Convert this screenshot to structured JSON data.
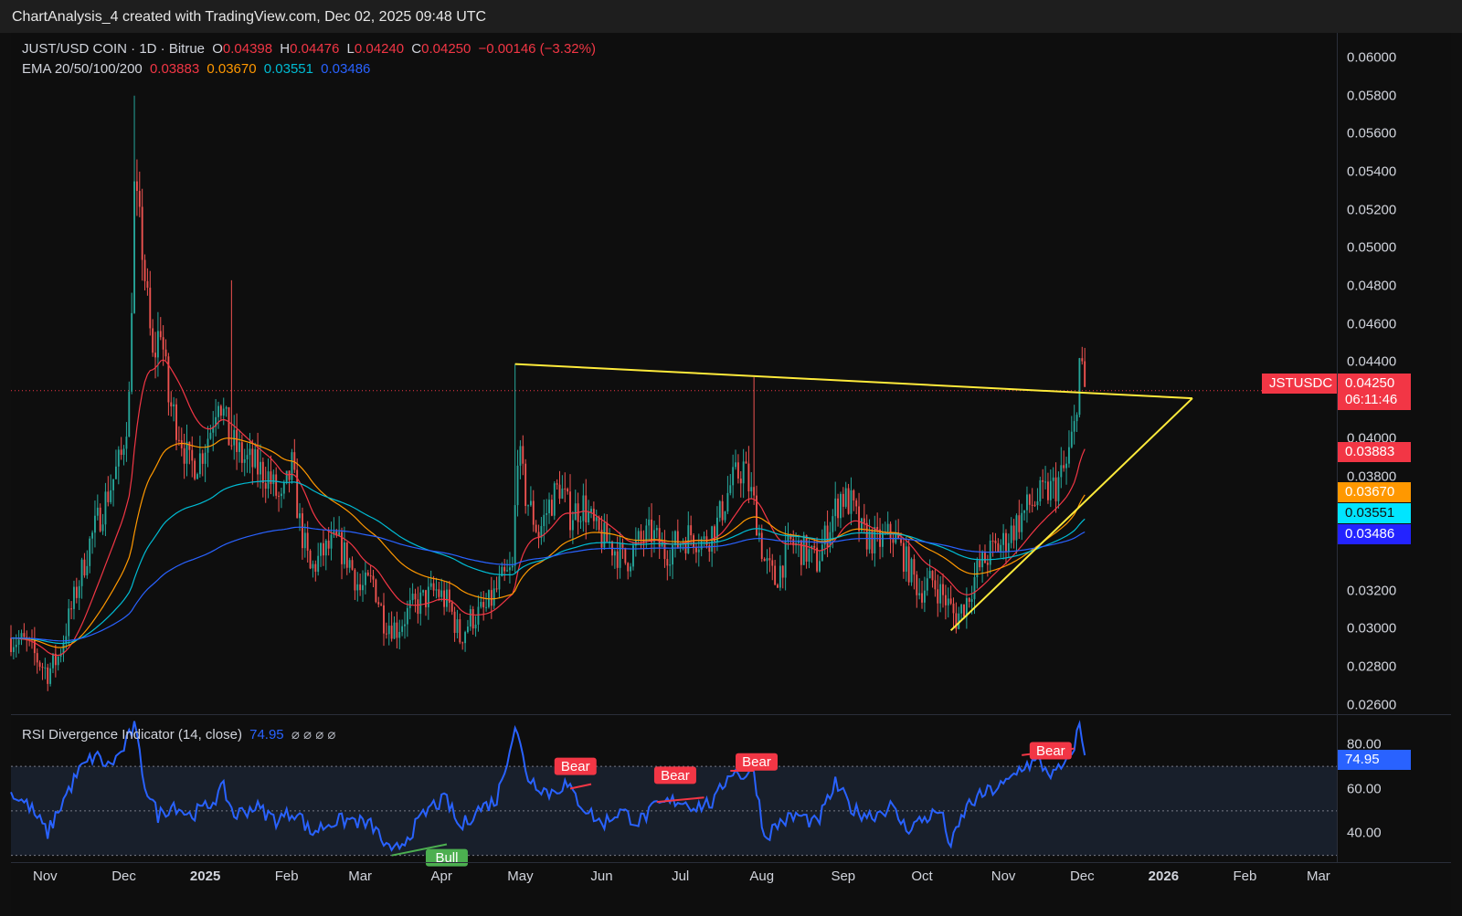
{
  "header": {
    "title": "ChartAnalysis_4 created with TradingView.com, Dec 02, 2025 09:48 UTC"
  },
  "legend": {
    "symbol": "JUST/USD COIN · 1D · Bitrue",
    "o_label": "O",
    "o": "0.04398",
    "h_label": "H",
    "h": "0.04476",
    "l_label": "L",
    "l": "0.04240",
    "c_label": "C",
    "c": "0.04250",
    "change": "−0.00146 (−3.32%)",
    "ema_label": "EMA 20/50/100/200",
    "ema20": "0.03883",
    "ema50": "0.03670",
    "ema100": "0.03551",
    "ema200": "0.03486"
  },
  "rsi_legend": {
    "label": "RSI Divergence Indicator (14, close)",
    "value": "74.95",
    "marks": "⌀ ⌀ ⌀ ⌀"
  },
  "colors": {
    "up": "#26a69a",
    "down": "#ef5350",
    "ema20": "#f23645",
    "ema50": "#ff9800",
    "ema100": "#00bcd4",
    "ema200": "#2962ff",
    "trend": "#ffeb3b",
    "rsi": "#2962ff"
  },
  "price_tags": {
    "symbol": "JSTUSDC",
    "price": "0.04250",
    "countdown": "06:11:46",
    "ema20": "0.03883",
    "ema50": "0.03670",
    "ema100": "0.03551",
    "ema200": "0.03486",
    "rsi": "74.95"
  },
  "chart_data": [
    {
      "type": "candlestick",
      "title": "JUST/USD COIN · 1D · Bitrue",
      "ylim": [
        0.0255,
        0.0613
      ],
      "y_ticks": [
        "0.06000",
        "0.05800",
        "0.05600",
        "0.05400",
        "0.05200",
        "0.05000",
        "0.04800",
        "0.04600",
        "0.04400",
        "0.04000",
        "0.03800",
        "0.03200",
        "0.03000",
        "0.02800",
        "0.02600"
      ],
      "x_ticks": [
        "Nov",
        "Dec",
        "2025",
        "Feb",
        "Mar",
        "Apr",
        "May",
        "Jun",
        "Jul",
        "Aug",
        "Sep",
        "Oct",
        "Nov",
        "Dec",
        "2026",
        "Feb",
        "Mar"
      ],
      "x_range": [
        "2024-10-19",
        "2026-03-08"
      ],
      "close_series": [
        [
          "2024-10-19",
          0.0295
        ],
        [
          "2024-10-25",
          0.0292
        ],
        [
          "2024-10-29",
          0.0284
        ],
        [
          "2024-11-02",
          0.0277
        ],
        [
          "2024-11-06",
          0.0285
        ],
        [
          "2024-11-10",
          0.0305
        ],
        [
          "2024-11-14",
          0.0325
        ],
        [
          "2024-11-18",
          0.0345
        ],
        [
          "2024-11-22",
          0.036
        ],
        [
          "2024-11-26",
          0.0375
        ],
        [
          "2024-11-30",
          0.039
        ],
        [
          "2024-12-03",
          0.042
        ],
        [
          "2024-12-05",
          0.053
        ],
        [
          "2024-12-08",
          0.05
        ],
        [
          "2024-12-12",
          0.044
        ],
        [
          "2024-12-15",
          0.046
        ],
        [
          "2024-12-18",
          0.042
        ],
        [
          "2024-12-22",
          0.0405
        ],
        [
          "2024-12-26",
          0.0385
        ],
        [
          "2024-12-30",
          0.039
        ],
        [
          "2025-01-03",
          0.0405
        ],
        [
          "2025-01-06",
          0.0425
        ],
        [
          "2025-01-10",
          0.04
        ],
        [
          "2025-01-15",
          0.039
        ],
        [
          "2025-01-20",
          0.0385
        ],
        [
          "2025-01-25",
          0.038
        ],
        [
          "2025-01-30",
          0.0365
        ],
        [
          "2025-02-03",
          0.0385
        ],
        [
          "2025-02-06",
          0.0355
        ],
        [
          "2025-02-10",
          0.033
        ],
        [
          "2025-02-15",
          0.034
        ],
        [
          "2025-02-20",
          0.0345
        ],
        [
          "2025-02-25",
          0.0335
        ],
        [
          "2025-03-01",
          0.032
        ],
        [
          "2025-03-06",
          0.0325
        ],
        [
          "2025-03-10",
          0.0305
        ],
        [
          "2025-03-15",
          0.03
        ],
        [
          "2025-03-20",
          0.031
        ],
        [
          "2025-03-25",
          0.0315
        ],
        [
          "2025-03-30",
          0.032
        ],
        [
          "2025-04-04",
          0.0312
        ],
        [
          "2025-04-08",
          0.0295
        ],
        [
          "2025-04-12",
          0.0305
        ],
        [
          "2025-04-18",
          0.031
        ],
        [
          "2025-04-24",
          0.0325
        ],
        [
          "2025-04-28",
          0.033
        ],
        [
          "2025-04-30",
          0.0395
        ],
        [
          "2025-05-03",
          0.037
        ],
        [
          "2025-05-08",
          0.035
        ],
        [
          "2025-05-12",
          0.0365
        ],
        [
          "2025-05-16",
          0.0375
        ],
        [
          "2025-05-20",
          0.036
        ],
        [
          "2025-05-25",
          0.0365
        ],
        [
          "2025-05-30",
          0.035
        ],
        [
          "2025-06-04",
          0.0345
        ],
        [
          "2025-06-10",
          0.0335
        ],
        [
          "2025-06-15",
          0.0345
        ],
        [
          "2025-06-20",
          0.035
        ],
        [
          "2025-06-25",
          0.034
        ],
        [
          "2025-06-30",
          0.0345
        ],
        [
          "2025-07-05",
          0.035
        ],
        [
          "2025-07-10",
          0.0345
        ],
        [
          "2025-07-15",
          0.0355
        ],
        [
          "2025-07-20",
          0.0375
        ],
        [
          "2025-07-25",
          0.0385
        ],
        [
          "2025-07-29",
          0.0365
        ],
        [
          "2025-08-02",
          0.0335
        ],
        [
          "2025-08-06",
          0.0325
        ],
        [
          "2025-08-12",
          0.0345
        ],
        [
          "2025-08-18",
          0.034
        ],
        [
          "2025-08-22",
          0.0335
        ],
        [
          "2025-08-27",
          0.0355
        ],
        [
          "2025-08-31",
          0.037
        ],
        [
          "2025-09-04",
          0.0365
        ],
        [
          "2025-09-08",
          0.035
        ],
        [
          "2025-09-14",
          0.0345
        ],
        [
          "2025-09-20",
          0.035
        ],
        [
          "2025-09-25",
          0.0335
        ],
        [
          "2025-09-30",
          0.032
        ],
        [
          "2025-10-05",
          0.0325
        ],
        [
          "2025-10-10",
          0.0315
        ],
        [
          "2025-10-14",
          0.0305
        ],
        [
          "2025-10-18",
          0.0315
        ],
        [
          "2025-10-22",
          0.033
        ],
        [
          "2025-10-27",
          0.034
        ],
        [
          "2025-11-01",
          0.0345
        ],
        [
          "2025-11-06",
          0.0355
        ],
        [
          "2025-11-11",
          0.0365
        ],
        [
          "2025-11-16",
          0.037
        ],
        [
          "2025-11-21",
          0.0375
        ],
        [
          "2025-11-25",
          0.0385
        ],
        [
          "2025-11-28",
          0.0405
        ],
        [
          "2025-11-30",
          0.044
        ],
        [
          "2025-12-02",
          0.0425
        ]
      ],
      "events": [
        {
          "date": "2024-12-05",
          "high": 0.058
        },
        {
          "date": "2025-01-11",
          "high": 0.0483
        },
        {
          "date": "2025-04-29",
          "high": 0.0439
        },
        {
          "date": "2025-07-29",
          "high": 0.0432
        },
        {
          "date": "2025-12-01",
          "high": 0.0448
        }
      ],
      "series": [
        {
          "name": "EMA 20",
          "last": 0.03883
        },
        {
          "name": "EMA 50",
          "last": 0.0367
        },
        {
          "name": "EMA 100",
          "last": 0.03551
        },
        {
          "name": "EMA 200",
          "last": 0.03486
        }
      ],
      "trendlines": [
        {
          "from": [
            "2025-04-29",
            0.0439
          ],
          "to": [
            "2026-01-12",
            0.0421
          ]
        },
        {
          "from": [
            "2025-10-12",
            0.0299
          ],
          "to": [
            "2026-01-12",
            0.0421
          ]
        }
      ]
    },
    {
      "type": "line",
      "title": "RSI Divergence Indicator (14, close)",
      "ylim": [
        27,
        93
      ],
      "y_ticks": [
        "80.00",
        "60.00",
        "40.00"
      ],
      "bands": [
        30,
        50,
        70
      ],
      "last": 74.95,
      "series": [
        [
          "2024-10-19",
          58
        ],
        [
          "2024-10-26",
          52
        ],
        [
          "2024-11-02",
          40
        ],
        [
          "2024-11-08",
          55
        ],
        [
          "2024-11-14",
          68
        ],
        [
          "2024-11-20",
          75
        ],
        [
          "2024-11-25",
          70
        ],
        [
          "2024-11-30",
          76
        ],
        [
          "2024-12-05",
          88
        ],
        [
          "2024-12-09",
          62
        ],
        [
          "2024-12-14",
          48
        ],
        [
          "2024-12-20",
          53
        ],
        [
          "2024-12-26",
          48
        ],
        [
          "2025-01-02",
          52
        ],
        [
          "2025-01-08",
          60
        ],
        [
          "2025-01-12",
          48
        ],
        [
          "2025-01-20",
          52
        ],
        [
          "2025-01-28",
          46
        ],
        [
          "2025-02-05",
          50
        ],
        [
          "2025-02-10",
          40
        ],
        [
          "2025-02-18",
          45
        ],
        [
          "2025-02-26",
          46
        ],
        [
          "2025-03-06",
          43
        ],
        [
          "2025-03-13",
          30
        ],
        [
          "2025-03-20",
          40
        ],
        [
          "2025-03-28",
          52
        ],
        [
          "2025-04-03",
          55
        ],
        [
          "2025-04-08",
          42
        ],
        [
          "2025-04-14",
          50
        ],
        [
          "2025-04-22",
          55
        ],
        [
          "2025-04-29",
          88
        ],
        [
          "2025-05-04",
          65
        ],
        [
          "2025-05-12",
          58
        ],
        [
          "2025-05-18",
          62
        ],
        [
          "2025-05-25",
          52
        ],
        [
          "2025-06-01",
          44
        ],
        [
          "2025-06-08",
          50
        ],
        [
          "2025-06-15",
          45
        ],
        [
          "2025-06-22",
          52
        ],
        [
          "2025-06-30",
          55
        ],
        [
          "2025-07-07",
          52
        ],
        [
          "2025-07-14",
          54
        ],
        [
          "2025-07-20",
          68
        ],
        [
          "2025-07-25",
          66
        ],
        [
          "2025-07-29",
          68
        ],
        [
          "2025-08-02",
          38
        ],
        [
          "2025-08-08",
          45
        ],
        [
          "2025-08-15",
          48
        ],
        [
          "2025-08-22",
          44
        ],
        [
          "2025-08-29",
          62
        ],
        [
          "2025-09-05",
          50
        ],
        [
          "2025-09-12",
          48
        ],
        [
          "2025-09-19",
          52
        ],
        [
          "2025-09-25",
          42
        ],
        [
          "2025-10-01",
          46
        ],
        [
          "2025-10-08",
          50
        ],
        [
          "2025-10-12",
          34
        ],
        [
          "2025-10-18",
          52
        ],
        [
          "2025-10-25",
          58
        ],
        [
          "2025-11-02",
          62
        ],
        [
          "2025-11-08",
          70
        ],
        [
          "2025-11-14",
          72
        ],
        [
          "2025-11-20",
          66
        ],
        [
          "2025-11-26",
          72
        ],
        [
          "2025-11-30",
          88
        ],
        [
          "2025-12-02",
          74.95
        ]
      ],
      "labels": [
        {
          "text": "Bull",
          "date": "2025-04-03",
          "value": 29,
          "kind": "bull"
        },
        {
          "text": "Bear",
          "date": "2025-05-22",
          "value": 70,
          "kind": "bear"
        },
        {
          "text": "Bear",
          "date": "2025-06-29",
          "value": 66,
          "kind": "bear"
        },
        {
          "text": "Bear",
          "date": "2025-07-30",
          "value": 72,
          "kind": "bear"
        },
        {
          "text": "Bear",
          "date": "2025-11-19",
          "value": 77,
          "kind": "bear"
        }
      ],
      "divergence_lines": [
        {
          "from": [
            "2025-03-13",
            30
          ],
          "to": [
            "2025-04-03",
            35
          ],
          "kind": "bull"
        },
        {
          "from": [
            "2025-05-20",
            60
          ],
          "to": [
            "2025-05-28",
            62
          ],
          "kind": "bear"
        },
        {
          "from": [
            "2025-06-22",
            54
          ],
          "to": [
            "2025-07-10",
            56
          ],
          "kind": "bear"
        },
        {
          "from": [
            "2025-07-20",
            68
          ],
          "to": [
            "2025-07-29",
            68
          ],
          "kind": "bear"
        },
        {
          "from": [
            "2025-11-08",
            75
          ],
          "to": [
            "2025-11-28",
            78
          ],
          "kind": "bear"
        }
      ]
    }
  ]
}
